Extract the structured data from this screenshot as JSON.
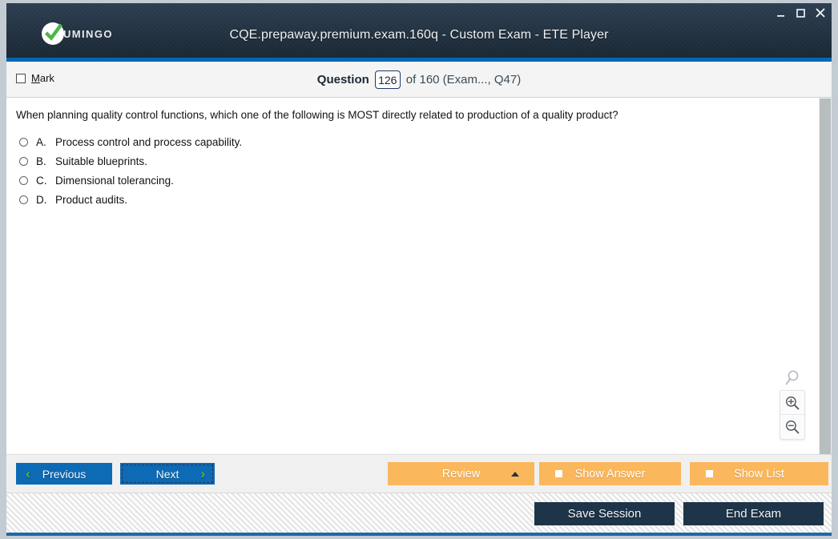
{
  "window": {
    "title": "CQE.prepaway.premium.exam.160q - Custom Exam - ETE Player",
    "brand": "UMINGO",
    "controls": {
      "minimize": "minimize-icon",
      "maximize": "maximize-icon",
      "close": "close-icon"
    }
  },
  "question_bar": {
    "mark_label_prefix": "M",
    "mark_label_rest": "ark",
    "question_word": "Question",
    "question_number": "126",
    "total_text": "of 160 (Exam..., Q47)"
  },
  "content": {
    "question_text": "When planning quality control functions, which one of the following is MOST directly related to production of a quality product?",
    "options": [
      {
        "letter": "A.",
        "text": "Process control and process capability."
      },
      {
        "letter": "B.",
        "text": "Suitable blueprints."
      },
      {
        "letter": "C.",
        "text": "Dimensional tolerancing."
      },
      {
        "letter": "D.",
        "text": "Product audits."
      }
    ],
    "zoom_tools": {
      "magnifier": "magnifier-icon",
      "zoom_in": "zoom-in-icon",
      "zoom_out": "zoom-out-icon"
    }
  },
  "nav_bar": {
    "previous_label": "Previous",
    "previous_chevron": "‹",
    "next_label": "Next",
    "next_chevron": "›",
    "review_label": "Review",
    "show_answer_label": "Show Answer",
    "show_list_label": "Show List"
  },
  "footer": {
    "save_session_label": "Save Session",
    "end_exam_label": "End Exam"
  },
  "colors": {
    "header_dark": "#253545",
    "accent_blue": "#0268b4",
    "button_blue": "#0d6ab5",
    "chevron_green": "#5cb72d",
    "orange": "#fab75c",
    "dark_navy": "#1d3449"
  }
}
